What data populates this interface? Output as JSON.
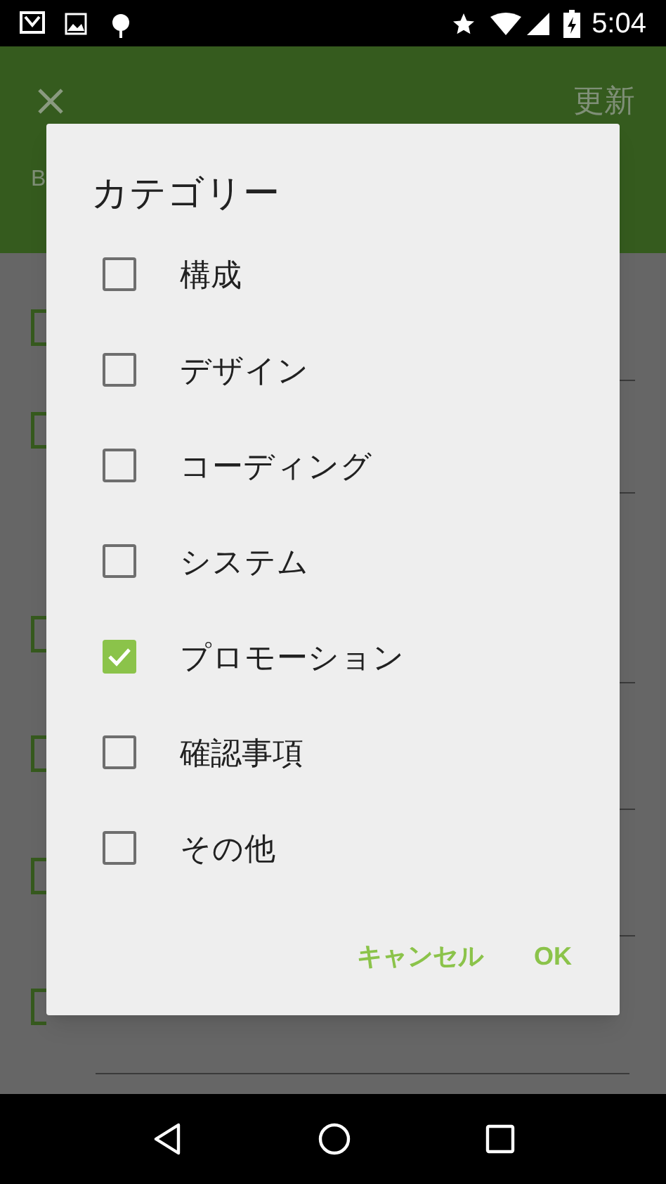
{
  "status_bar": {
    "time": "5:04"
  },
  "app_bar": {
    "action": "更新",
    "subtitle": "B"
  },
  "dialog": {
    "title": "カテゴリー",
    "options": [
      {
        "label": "構成",
        "checked": false
      },
      {
        "label": "デザイン",
        "checked": false
      },
      {
        "label": "コーディング",
        "checked": false
      },
      {
        "label": "システム",
        "checked": false
      },
      {
        "label": "プロモーション",
        "checked": true
      },
      {
        "label": "確認事項",
        "checked": false
      },
      {
        "label": "その他",
        "checked": false
      }
    ],
    "buttons": [
      "キャンセル",
      "OK"
    ]
  }
}
